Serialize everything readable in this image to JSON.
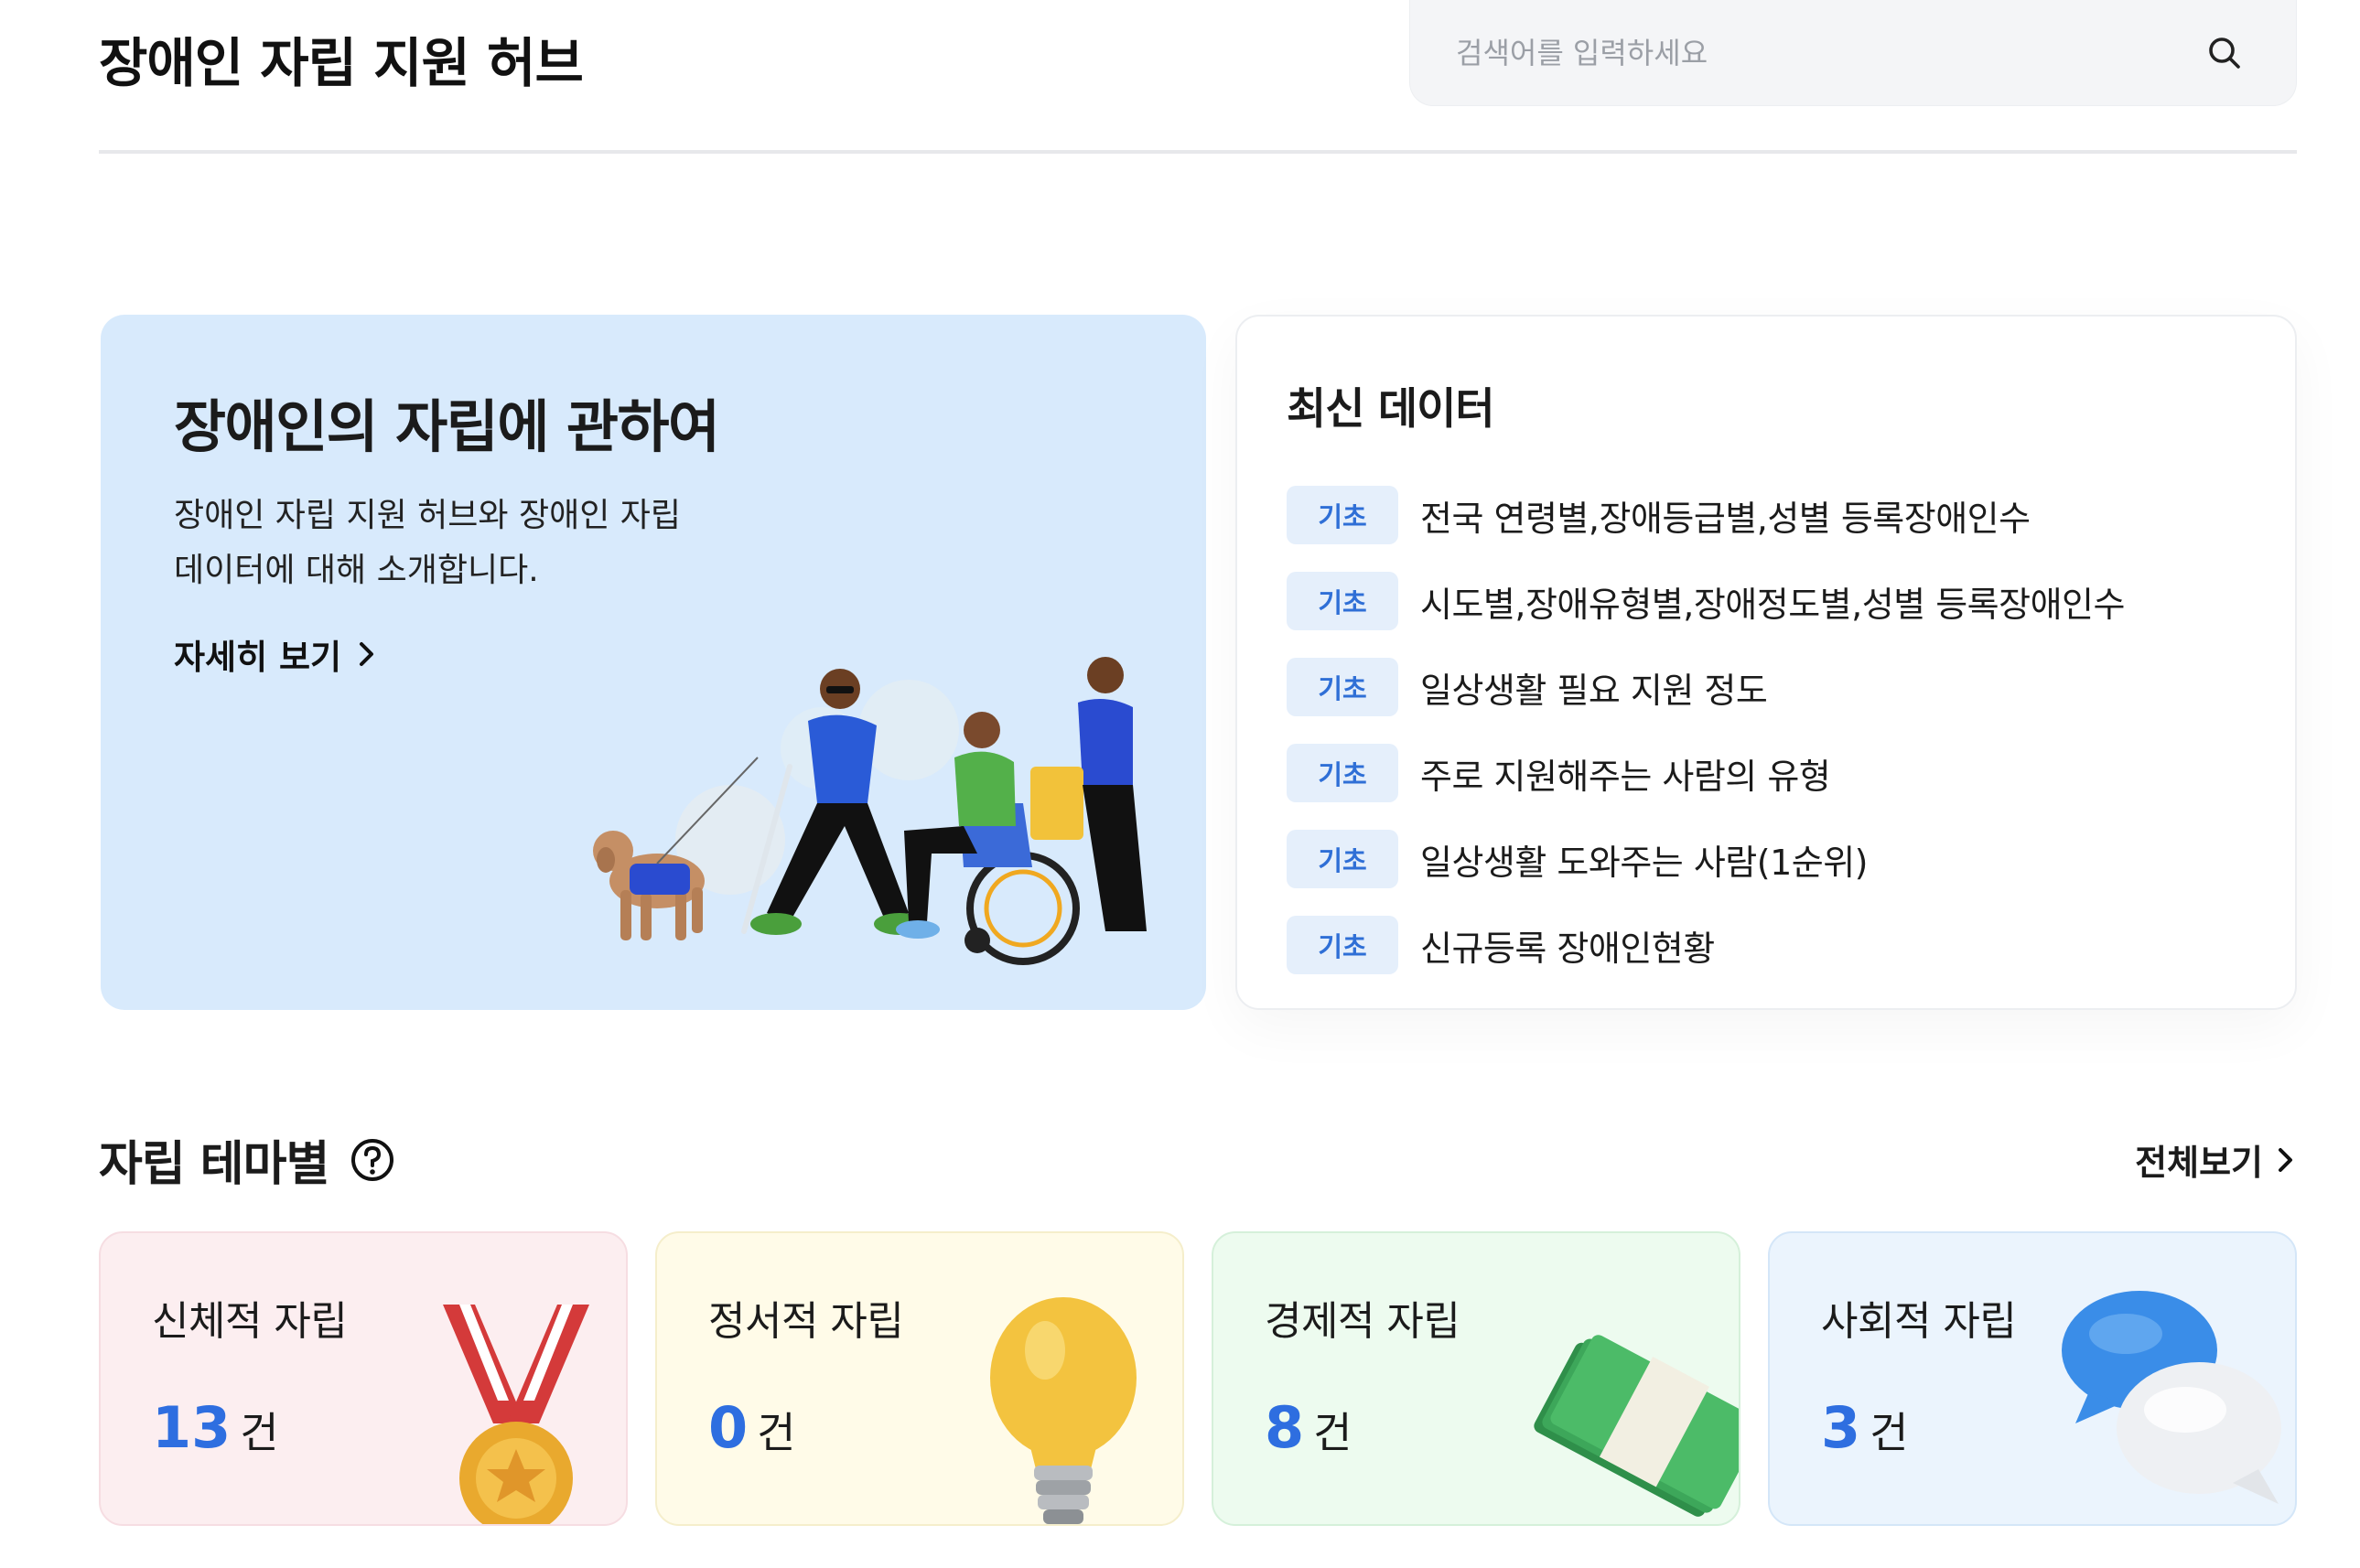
{
  "header": {
    "title": "장애인 자립 지원 허브",
    "search_placeholder": "검색어를 입력하세요"
  },
  "intro": {
    "title": "장애인의 자립에 관하여",
    "description_line1": "장애인 자립 지원 허브와 장애인 자립",
    "description_line2": "데이터에 대해 소개합니다.",
    "more_label": "자세히 보기"
  },
  "latest": {
    "title": "최신 데이터",
    "items": [
      {
        "badge": "기초",
        "text": "전국 연령별,장애등급별,성별 등록장애인수"
      },
      {
        "badge": "기초",
        "text": "시도별,장애유형별,장애정도별,성별 등록장애인수"
      },
      {
        "badge": "기초",
        "text": "일상생활 필요 지원 정도"
      },
      {
        "badge": "기초",
        "text": "주로 지원해주는 사람의 유형"
      },
      {
        "badge": "기초",
        "text": "일상생활 도와주는 사람(1순위)"
      },
      {
        "badge": "기초",
        "text": "신규등록 장애인현황"
      }
    ]
  },
  "themes": {
    "title": "자립 테마별",
    "view_all": "전체보기",
    "unit": "건",
    "cards": [
      {
        "name": "신체적 자립",
        "count": "13",
        "icon": "medal-icon",
        "bg": "#fceef0"
      },
      {
        "name": "정서적 자립",
        "count": "0",
        "icon": "lightbulb-icon",
        "bg": "#fffbe8"
      },
      {
        "name": "경제적 자립",
        "count": "8",
        "icon": "money-stack-icon",
        "bg": "#edfbef"
      },
      {
        "name": "사회적 자립",
        "count": "3",
        "icon": "speech-bubbles-icon",
        "bg": "#ebf4fd"
      }
    ]
  },
  "colors": {
    "accent": "#2e6ee0",
    "badge_text": "#2f6fd6",
    "badge_bg": "#e5effb",
    "intro_bg": "#d8eafc"
  }
}
